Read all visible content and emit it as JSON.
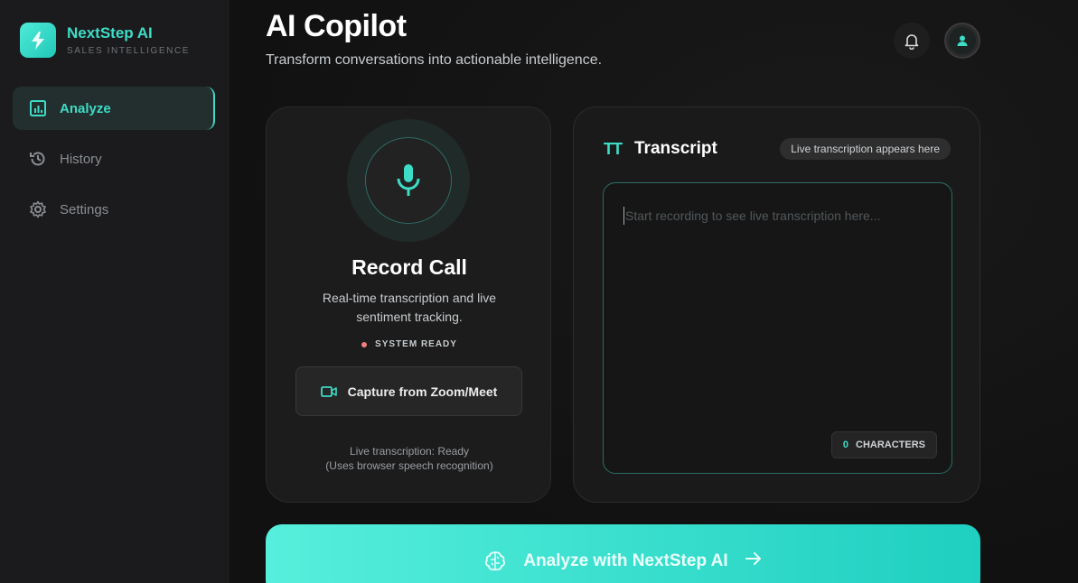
{
  "brand": {
    "name": "NextStep AI",
    "subtitle": "SALES INTELLIGENCE"
  },
  "nav": [
    {
      "label": "Analyze",
      "icon": "chart-icon",
      "active": true
    },
    {
      "label": "History",
      "icon": "history-icon",
      "active": false
    },
    {
      "label": "Settings",
      "icon": "gear-icon",
      "active": false
    }
  ],
  "header": {
    "title": "AI Copilot",
    "subtitle": "Transform conversations into actionable intelligence."
  },
  "record": {
    "title": "Record Call",
    "description": "Real-time transcription and live sentiment tracking.",
    "status": "SYSTEM READY",
    "capture_label": "Capture from Zoom/Meet",
    "live_line1": "Live transcription: Ready",
    "live_line2": "(Uses browser speech recognition)"
  },
  "transcript": {
    "icon_text": "TT",
    "title": "Transcript",
    "badge": "Live transcription appears here",
    "placeholder": "Start recording to see live transcription here...",
    "char_count": "0",
    "char_label": "CHARACTERS"
  },
  "analyze": {
    "label": "Analyze with NextStep AI"
  },
  "colors": {
    "accent": "#3ddcc6",
    "status_dot": "#f08080"
  }
}
